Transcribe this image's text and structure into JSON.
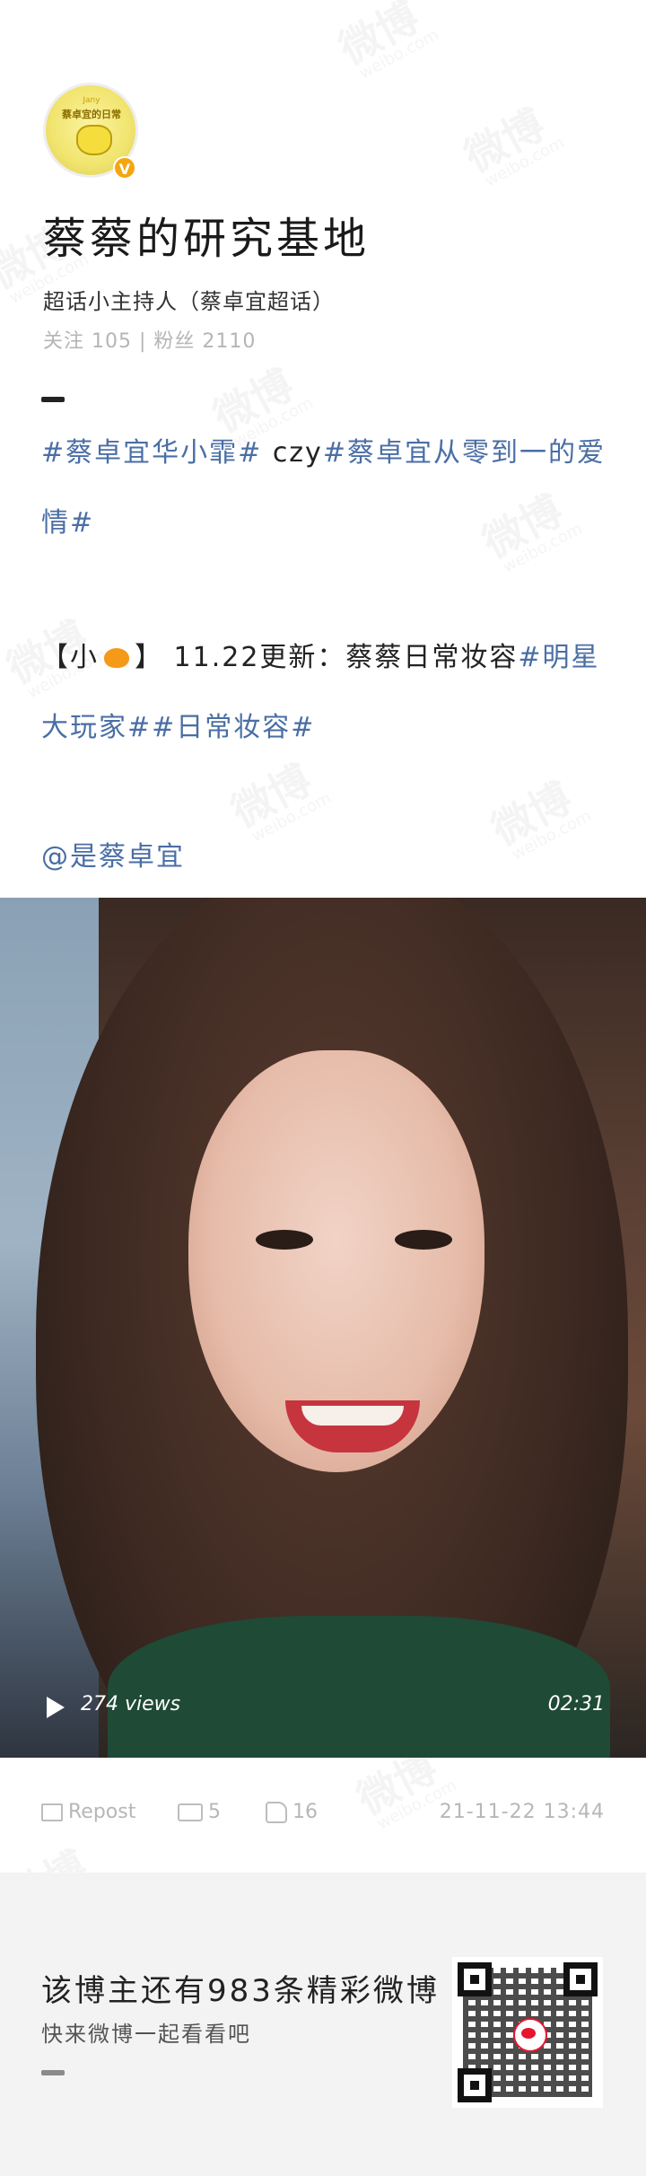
{
  "profile": {
    "avatar_text": "Jany",
    "avatar_badge": "蔡卓宜的日常",
    "verified_mark": "V",
    "name": "蔡蔡的研究基地",
    "role": "超话小主持人（蔡卓宜超话）",
    "stats": "关注 105 | 粉丝 2110"
  },
  "post": {
    "line1_tag1": "#蔡卓宜华小霏#",
    "line1_text": " czy",
    "line1_tag2": "#蔡卓宜从零到一的爱情#",
    "line2_prefix": "【小",
    "line2_bracket": "】 11.22更新：蔡蔡日常妆容",
    "line2_tag1": "#明星大玩家#",
    "line2_tag2": "#日常妆容#",
    "mention": "@是蔡卓宜"
  },
  "video": {
    "views": "274 views",
    "duration": "02:31"
  },
  "actions": {
    "repost_label": "Repost",
    "comments": "5",
    "likes": "16",
    "timestamp": "21-11-22 13:44"
  },
  "footer": {
    "title": "该博主还有983条精彩微博",
    "subtitle": "快来微博一起看看吧"
  },
  "watermark": {
    "main": "微博",
    "sub": "weibo.com"
  }
}
